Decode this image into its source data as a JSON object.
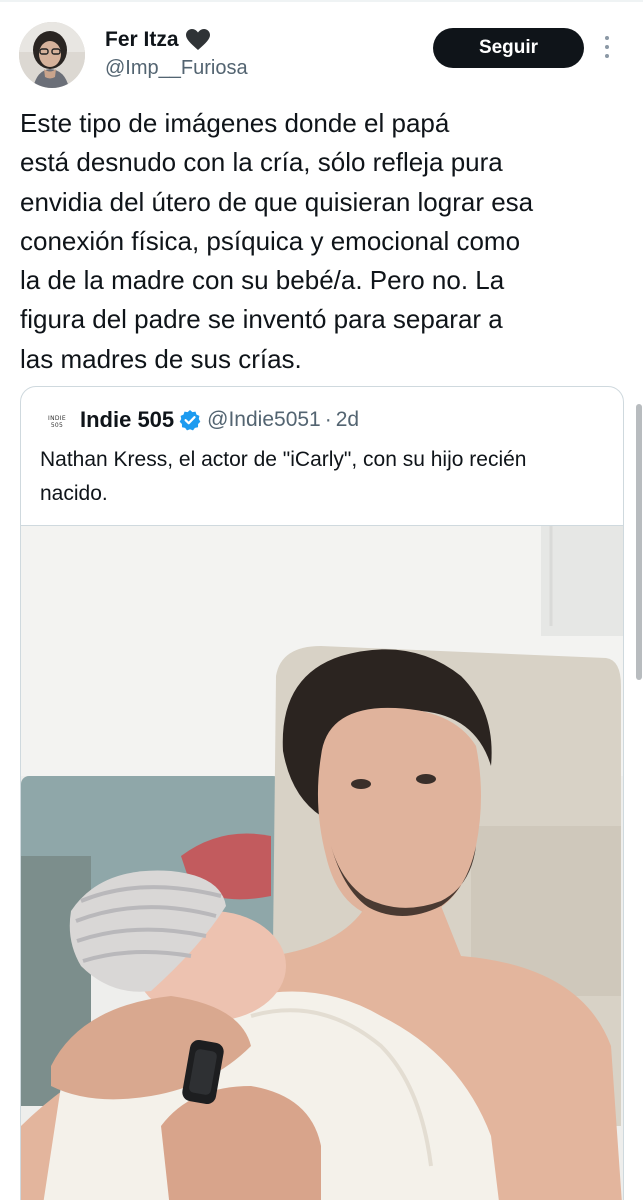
{
  "author": {
    "name": "Fer Itza",
    "name_emoji_icon": "black-heart-icon",
    "handle": "@Imp__Furiosa"
  },
  "follow_button": {
    "label": "Seguir"
  },
  "more_options_icon": "more-options-icon",
  "tweet": {
    "text": "Este tipo de imágenes donde el papá\nestá desnudo con la cría, sólo refleja pura\nenvidia del útero de que quisieran lograr esa\nconexión física, psíquica y emocional como\nla de la madre con su bebé/a. Pero no. La\nfigura del padre se inventó para separar a\nlas madres de sus crías."
  },
  "quoted_tweet": {
    "avatar_text_line1": "INDIE",
    "avatar_text_line2": "505",
    "author_name": "Indie 505",
    "verified_icon": "verified-badge-icon",
    "handle": "@Indie5051",
    "separator": "·",
    "time": "2d",
    "text": "Nathan Kress, el actor  de \"iCarly\", con su hijo recién nacido."
  },
  "colors": {
    "text_primary": "#0f1419",
    "text_secondary": "#536471",
    "follow_button_bg": "#0f1419",
    "verified_blue": "#1d9bf0",
    "border": "#cfd9de"
  }
}
